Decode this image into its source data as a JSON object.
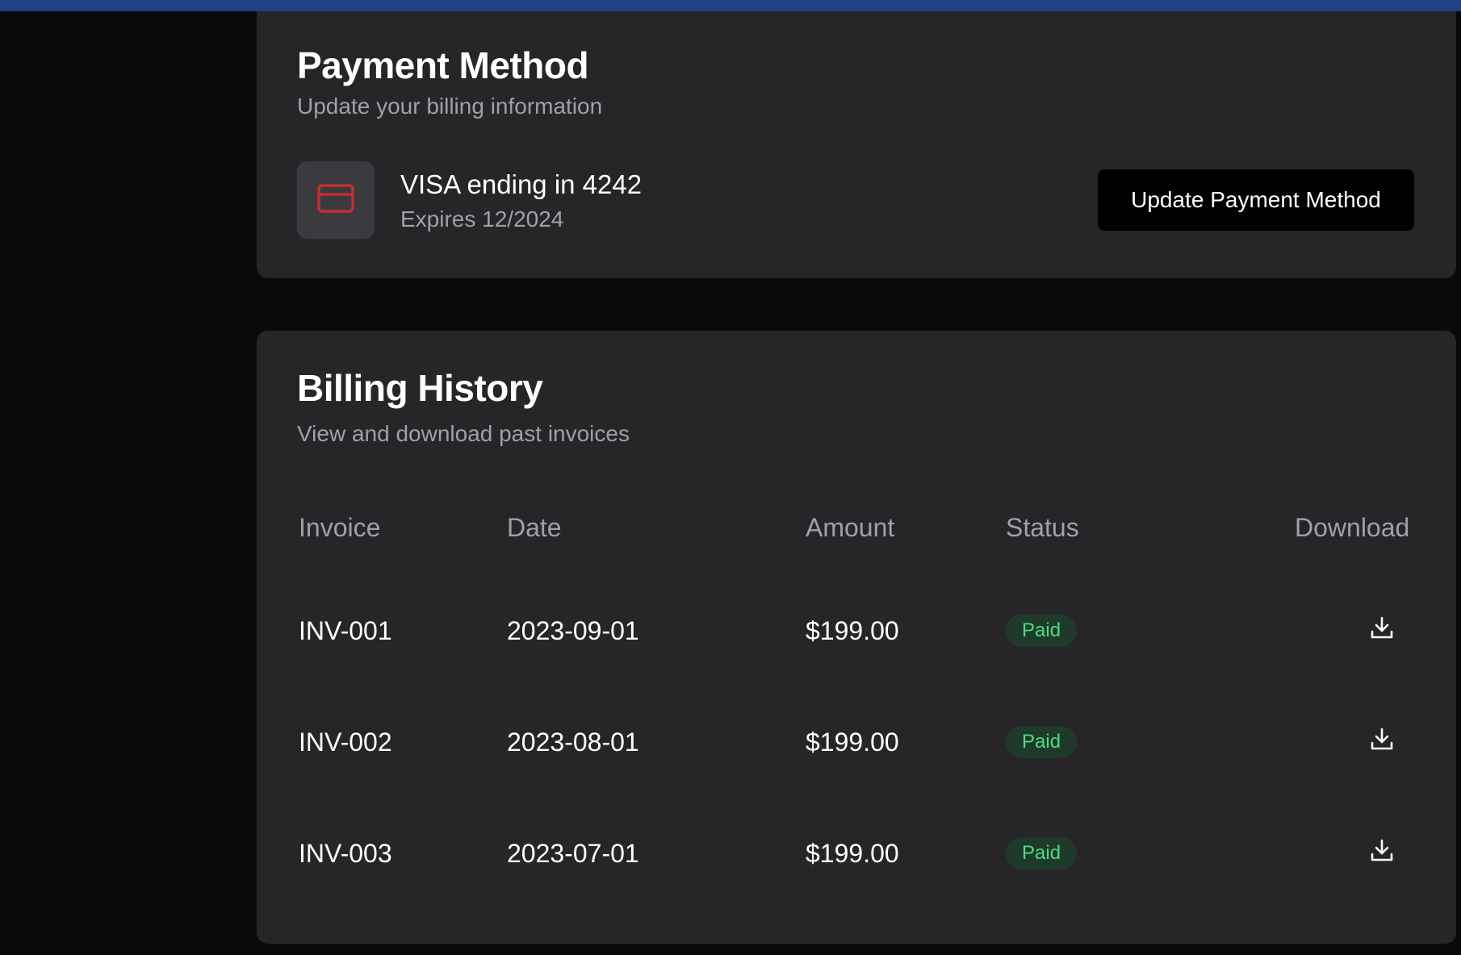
{
  "payment": {
    "title": "Payment Method",
    "subtitle": "Update your billing information",
    "card_label": "VISA ending in 4242",
    "card_expiry": "Expires 12/2024",
    "update_button": "Update Payment Method",
    "card_icon": "credit-card-icon",
    "card_icon_color": "#c0302e"
  },
  "billing": {
    "title": "Billing History",
    "subtitle": "View and download past invoices",
    "columns": [
      "Invoice",
      "Date",
      "Amount",
      "Status",
      "Download"
    ],
    "rows": [
      {
        "invoice": "INV-001",
        "date": "2023-09-01",
        "amount": "$199.00",
        "status": "Paid"
      },
      {
        "invoice": "INV-002",
        "date": "2023-08-01",
        "amount": "$199.00",
        "status": "Paid"
      },
      {
        "invoice": "INV-003",
        "date": "2023-07-01",
        "amount": "$199.00",
        "status": "Paid"
      }
    ],
    "download_icon": "download-icon",
    "status_color": "#4ade80"
  },
  "colors": {
    "background": "#0a0a0c",
    "card": "#262629",
    "top_bar": "#1e4384"
  }
}
